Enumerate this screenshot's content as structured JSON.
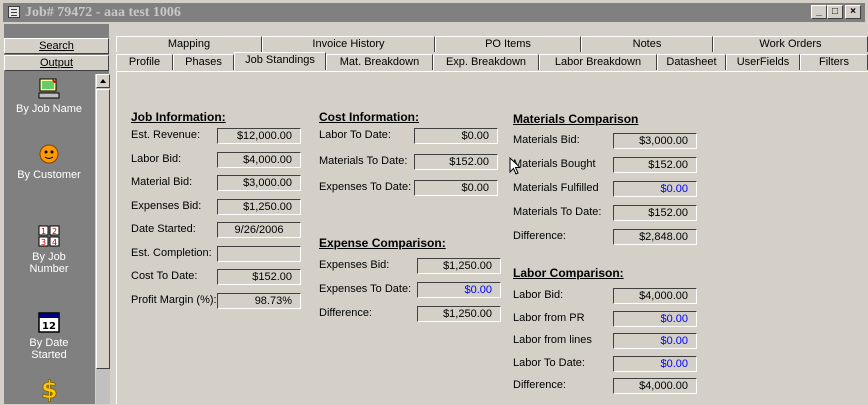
{
  "window": {
    "title": "Job# 79472 - aaa test 1006",
    "buttons": [
      "_",
      "□",
      "×"
    ]
  },
  "sidebar": {
    "search_label": "Search",
    "output_label": "Output",
    "items": [
      {
        "label": "By Job Name",
        "icon": "computer-user-icon"
      },
      {
        "label": "By Customer",
        "icon": "customer-face-icon"
      },
      {
        "label": "By Job Number",
        "icon": "numbers-grid-icon"
      },
      {
        "label": "By Date Started",
        "icon": "calendar-icon"
      },
      {
        "label": "",
        "icon": "dollar-icon"
      }
    ]
  },
  "tabs_top": [
    "Mapping",
    "Invoice History",
    "PO Items",
    "Notes",
    "Work Orders"
  ],
  "tabs_bottom": [
    "Profile",
    "Phases",
    "Job Standings",
    "Mat. Breakdown",
    "Exp. Breakdown",
    "Labor Breakdown",
    "Datasheet",
    "UserFields",
    "Filters"
  ],
  "active_tab": "Job Standings",
  "job_info": {
    "heading": "Job Information:",
    "rows": [
      {
        "label": "Est. Revenue:",
        "value": "$12,000.00"
      },
      {
        "label": "Labor Bid:",
        "value": "$4,000.00"
      },
      {
        "label": "Material Bid:",
        "value": "$3,000.00"
      },
      {
        "label": "Expenses Bid:",
        "value": "$1,250.00"
      },
      {
        "label": "Date Started:",
        "value": "9/26/2006"
      },
      {
        "label": "Est. Completion:",
        "value": ""
      },
      {
        "label": "Cost To Date:",
        "value": "$152.00"
      },
      {
        "label": "Profit Margin (%):",
        "value": "98.73%"
      }
    ]
  },
  "cost_info": {
    "heading": "Cost Information:",
    "rows": [
      {
        "label": "Labor To Date:",
        "value": "$0.00"
      },
      {
        "label": "Materials To Date:",
        "value": "$152.00"
      },
      {
        "label": "Expenses To Date:",
        "value": "$0.00"
      }
    ]
  },
  "expense_comparison": {
    "heading": "Expense Comparison:",
    "rows": [
      {
        "label": "Expenses Bid:",
        "value": "$1,250.00"
      },
      {
        "label": "Expenses To Date:",
        "value": "$0.00"
      },
      {
        "label": "Difference:",
        "value": "$1,250.00"
      }
    ]
  },
  "materials_comparison": {
    "heading": "Materials Comparison",
    "rows": [
      {
        "label": "Materials Bid:",
        "value": "$3,000.00"
      },
      {
        "label": "Materials Bought",
        "value": "$152.00"
      },
      {
        "label": "Materials Fulfilled",
        "value": "$0.00"
      },
      {
        "label": "Materials To Date:",
        "value": "$152.00"
      },
      {
        "label": "Difference:",
        "value": "$2,848.00"
      }
    ]
  },
  "labor_comparison": {
    "heading": "Labor Comparison:",
    "rows": [
      {
        "label": "Labor Bid:",
        "value": "$4,000.00"
      },
      {
        "label": "Labor from PR",
        "value": "$0.00"
      },
      {
        "label": "Labor from lines",
        "value": "$0.00"
      },
      {
        "label": "Labor To Date:",
        "value": "$0.00"
      },
      {
        "label": "Difference:",
        "value": "$4,000.00"
      }
    ]
  },
  "colors": {
    "linked_value": "#0000ff",
    "face": "#d4d0c8",
    "titlebar_inactive": "#808080"
  }
}
